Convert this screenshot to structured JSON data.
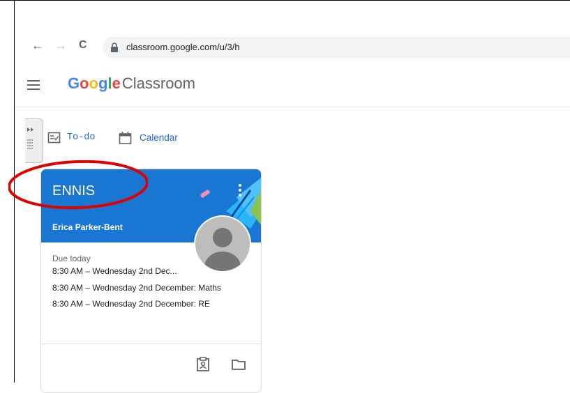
{
  "browser": {
    "back_icon": "←",
    "forward_icon": "→",
    "reload_icon": "C",
    "url": "classroom.google.com/u/3/h"
  },
  "app": {
    "brand_letters": [
      "G",
      "o",
      "o",
      "g",
      "l",
      "e"
    ],
    "brand_colors": [
      "#4285f4",
      "#ea4335",
      "#fbbc05",
      "#4285f4",
      "#34a853",
      "#ea4335"
    ],
    "product": "Classroom"
  },
  "nav": {
    "todo": "To-do",
    "calendar": "Calendar"
  },
  "card": {
    "title": "ENNIS",
    "teacher": "Erica Parker-Bent",
    "due_label": "Due today",
    "due_items": [
      "8:30 AM – Wednesday 2nd Dec...",
      "8:30 AM – Wednesday 2nd December: Maths",
      "8:30 AM – Wednesday 2nd December: RE"
    ],
    "header_color": "#1976d2"
  },
  "annotation": {
    "color": "#e00000"
  }
}
